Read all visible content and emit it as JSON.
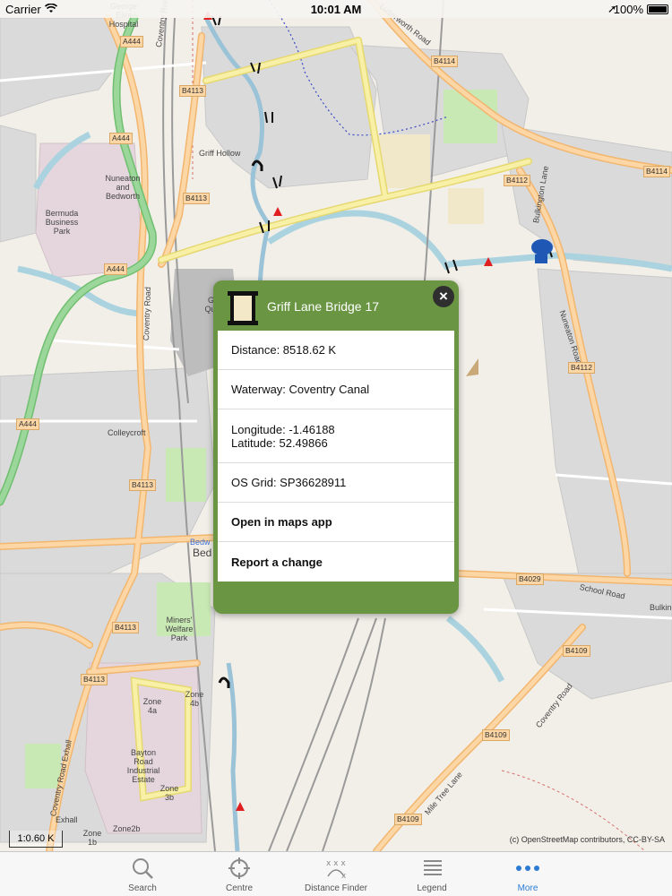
{
  "status_bar": {
    "carrier": "Carrier",
    "time": "10:01 AM",
    "battery": "100%"
  },
  "map": {
    "labels": {
      "george_eliot": "George\nEliot\nHospital",
      "griff_hollow": "Griff Hollow",
      "nuneaton": "Nuneaton\nand\nBedworth",
      "bermuda": "Bermuda\nBusiness\nPark",
      "coventry_road_w": "Coventry Road",
      "coventry_road_n": "Coventry Road",
      "lutterworth_road": "Lutterworth Road",
      "bulkington_lane": "Bulkington Lane",
      "nuneaton_road": "Nuneaton Road",
      "school_road": "School Road",
      "bulkin": "Bulkin",
      "miners_welfare": "Miners'\nWelfare\nPark",
      "colleycroft": "Colleycroft",
      "bedworth": "Bedw",
      "bed": "Bed",
      "zone4a": "Zone\n4a",
      "zone4b": "Zone\n4b",
      "bayton": "Bayton\nRoad\nIndustrial\nEstate",
      "zone3b": "Zone\n3b",
      "zone2b": "Zone2b",
      "zone1b": "Zone\n1b",
      "exhall": "Exhall",
      "coventry_road_exhall": "Coventry Road Exhall",
      "mile_tree_lane": "Mile Tree Lane",
      "coventry_road_se": "Coventry Road",
      "griff_q": "Gr\nQua"
    },
    "shields": {
      "a444_top": "A444",
      "a444_mid": "A444",
      "a444_lower": "A444",
      "a444_left": "A444",
      "b4113_top": "B4113",
      "b4113_mid": "B4113",
      "b4113_l1": "B4113",
      "b4113_l2": "B4113",
      "b4113_l3": "B4113",
      "b4114_top": "B4114",
      "b4114_right": "B4114",
      "b4112_a": "B4112",
      "b4112_b": "B4112",
      "b4029": "B4029",
      "b4109_a": "B4109",
      "b4109_b": "B4109",
      "b4109_c": "B4109"
    },
    "scale": "1:0.60 K",
    "attribution": "(c) OpenStreetMap contributors, CC-BY-SA"
  },
  "popup": {
    "title": "Griff Lane Bridge 17",
    "distance": "Distance: 8518.62 K",
    "waterway": "Waterway: Coventry Canal",
    "longitude": "Longitude: -1.46188",
    "latitude": "Latitude: 52.49866",
    "os_grid": "OS Grid: SP36628911",
    "open_maps": "Open in maps app",
    "report": "Report a change"
  },
  "tabs": [
    {
      "label": "Search",
      "icon": "search-icon"
    },
    {
      "label": "Centre",
      "icon": "crosshair-icon"
    },
    {
      "label": "Distance Finder",
      "icon": "distance-finder-icon"
    },
    {
      "label": "Legend",
      "icon": "list-icon"
    },
    {
      "label": "More",
      "icon": "more-dots-icon"
    }
  ],
  "colors": {
    "popup_green": "#6a9543",
    "active_tab": "#2b7ad3",
    "canal": "#aad3df",
    "road_major": "#fcd6a4"
  }
}
